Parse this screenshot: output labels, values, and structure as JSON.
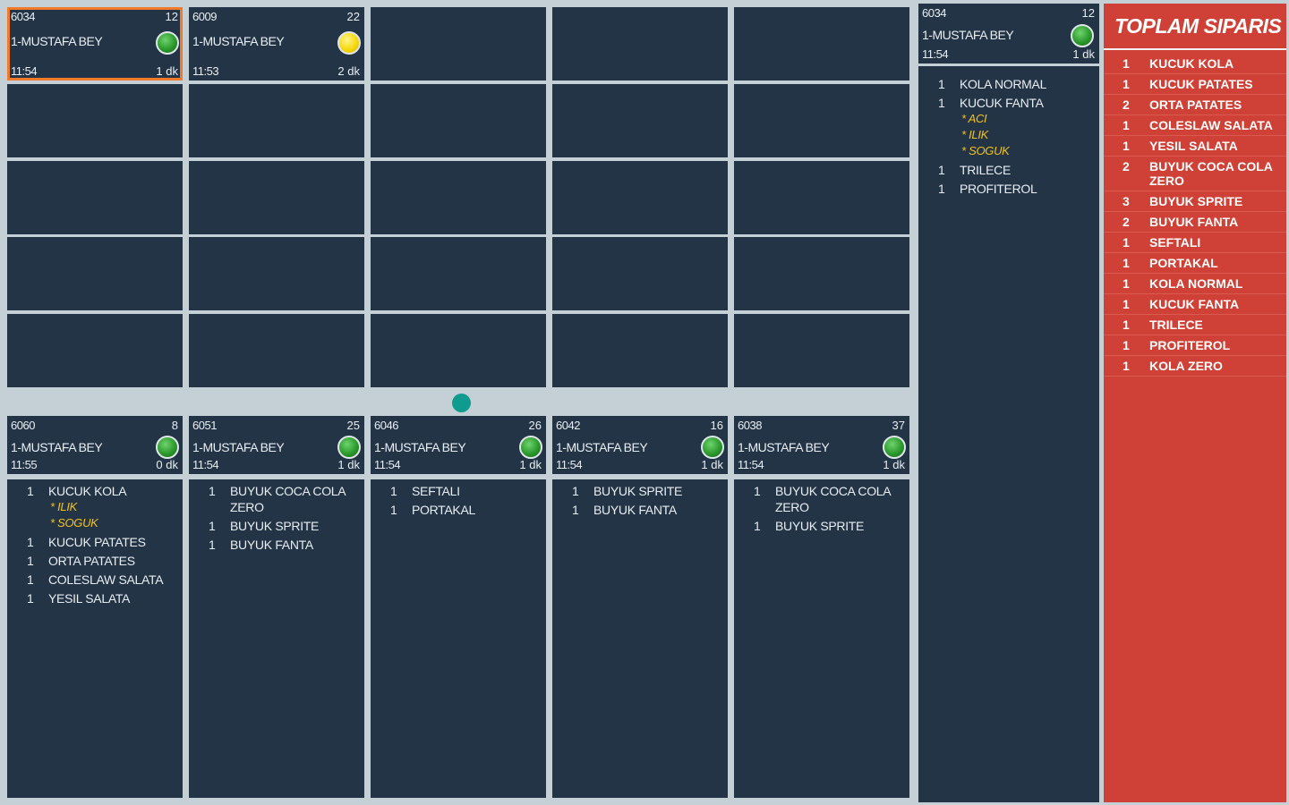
{
  "grid_top": [
    {
      "number": "6034",
      "count": "12",
      "name": "1-MUSTAFA BEY",
      "time": "11:54",
      "elapsed": "1 dk",
      "status": "green",
      "selected": true
    },
    {
      "number": "6009",
      "count": "22",
      "name": "1-MUSTAFA BEY",
      "time": "11:53",
      "elapsed": "2 dk",
      "status": "yellow",
      "selected": false
    }
  ],
  "bottom_orders": [
    {
      "number": "6060",
      "count": "8",
      "name": "1-MUSTAFA BEY",
      "time": "11:55",
      "elapsed": "0 dk",
      "status": "green",
      "items": [
        {
          "qty": "1",
          "name": "KUCUK KOLA",
          "mods": [
            "* ILIK",
            "* SOGUK"
          ]
        },
        {
          "qty": "1",
          "name": "KUCUK PATATES",
          "mods": []
        },
        {
          "qty": "1",
          "name": "ORTA PATATES",
          "mods": []
        },
        {
          "qty": "1",
          "name": "COLESLAW SALATA",
          "mods": []
        },
        {
          "qty": "1",
          "name": "YESIL SALATA",
          "mods": []
        }
      ]
    },
    {
      "number": "6051",
      "count": "25",
      "name": "1-MUSTAFA BEY",
      "time": "11:54",
      "elapsed": "1 dk",
      "status": "green",
      "items": [
        {
          "qty": "1",
          "name": "BUYUK COCA COLA ZERO",
          "mods": []
        },
        {
          "qty": "1",
          "name": "BUYUK SPRITE",
          "mods": []
        },
        {
          "qty": "1",
          "name": "BUYUK FANTA",
          "mods": []
        }
      ]
    },
    {
      "number": "6046",
      "count": "26",
      "name": "1-MUSTAFA BEY",
      "time": "11:54",
      "elapsed": "1 dk",
      "status": "green",
      "items": [
        {
          "qty": "1",
          "name": "SEFTALI",
          "mods": []
        },
        {
          "qty": "1",
          "name": "PORTAKAL",
          "mods": []
        }
      ]
    },
    {
      "number": "6042",
      "count": "16",
      "name": "1-MUSTAFA BEY",
      "time": "11:54",
      "elapsed": "1 dk",
      "status": "green",
      "items": [
        {
          "qty": "1",
          "name": "BUYUK SPRITE",
          "mods": []
        },
        {
          "qty": "1",
          "name": "BUYUK FANTA",
          "mods": []
        }
      ]
    },
    {
      "number": "6038",
      "count": "37",
      "name": "1-MUSTAFA BEY",
      "time": "11:54",
      "elapsed": "1 dk",
      "status": "green",
      "items": [
        {
          "qty": "1",
          "name": "BUYUK COCA COLA ZERO",
          "mods": []
        },
        {
          "qty": "1",
          "name": "BUYUK SPRITE",
          "mods": []
        }
      ]
    }
  ],
  "detail": {
    "number": "6034",
    "count": "12",
    "name": "1-MUSTAFA BEY",
    "time": "11:54",
    "elapsed": "1 dk",
    "status": "green",
    "items": [
      {
        "qty": "1",
        "name": "KOLA NORMAL",
        "mods": []
      },
      {
        "qty": "1",
        "name": "KUCUK FANTA",
        "mods": [
          "* ACI",
          "* ILIK",
          "* SOGUK"
        ]
      },
      {
        "qty": "1",
        "name": "TRILECE",
        "mods": []
      },
      {
        "qty": "1",
        "name": "PROFITEROL",
        "mods": []
      }
    ]
  },
  "totals": {
    "title": "TOPLAM SIPARIS",
    "rows": [
      {
        "qty": "1",
        "name": "KUCUK KOLA"
      },
      {
        "qty": "1",
        "name": "KUCUK PATATES"
      },
      {
        "qty": "2",
        "name": "ORTA PATATES"
      },
      {
        "qty": "1",
        "name": "COLESLAW SALATA"
      },
      {
        "qty": "1",
        "name": "YESIL SALATA"
      },
      {
        "qty": "2",
        "name": "BUYUK COCA COLA ZERO"
      },
      {
        "qty": "3",
        "name": "BUYUK SPRITE"
      },
      {
        "qty": "2",
        "name": "BUYUK FANTA"
      },
      {
        "qty": "1",
        "name": "SEFTALI"
      },
      {
        "qty": "1",
        "name": "PORTAKAL"
      },
      {
        "qty": "1",
        "name": "KOLA NORMAL"
      },
      {
        "qty": "1",
        "name": "KUCUK FANTA"
      },
      {
        "qty": "1",
        "name": "TRILECE"
      },
      {
        "qty": "1",
        "name": "PROFITEROL"
      },
      {
        "qty": "1",
        "name": "KOLA ZERO"
      }
    ]
  },
  "colors": {
    "cell_bg": "#243447",
    "page_bg": "#c5cfd6",
    "selected_border": "#f07a2a",
    "modifier_text": "#f2c21b",
    "totals_bg": "#cf4136",
    "handle": "#0f9b8e"
  }
}
